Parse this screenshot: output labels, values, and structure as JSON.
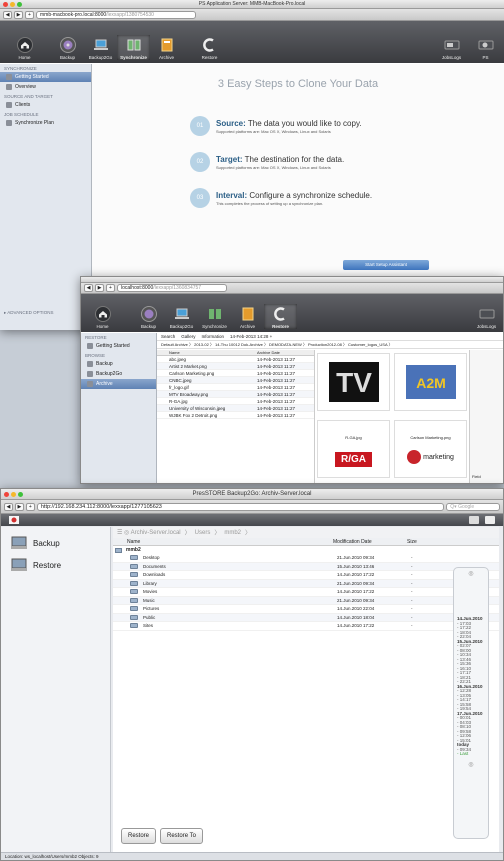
{
  "win1": {
    "title": "PS Application Server: MMB-MacBook-Pro.local",
    "url_host": "mmb-macbook-pro.local:8000",
    "url_path": "/lexxapp/1380754530",
    "toolbar": [
      {
        "label": "Home",
        "icon": "home-icon"
      },
      {
        "label": "Backup",
        "icon": "backup-icon"
      },
      {
        "label": "Backup2Go",
        "icon": "backup2go-icon"
      },
      {
        "label": "Synchronize",
        "icon": "synchronize-icon"
      },
      {
        "label": "Archive",
        "icon": "archive-icon"
      },
      {
        "label": "Restore",
        "icon": "restore-icon"
      }
    ],
    "toolbar_right": [
      {
        "label": "JobsLogs"
      },
      {
        "label": "PS"
      }
    ],
    "sidebar": {
      "h1": "SYNCHRONIZE",
      "getting_started": "Getting Started",
      "overview": "Overview",
      "h2": "SOURCE AND TARGET",
      "clients": "Clients",
      "h3": "JOB SCHEDULE",
      "sync_plan": "Synchronize Plan",
      "advanced": "ADVANCED OPTIONS"
    },
    "heading": "3 Easy Steps to Clone Your Data",
    "steps": [
      {
        "num": "01",
        "key": "Source:",
        "text": " The data you would like to copy.",
        "sub": "Supported platforms are: Mac OS X, Windows, Linux and Solaris"
      },
      {
        "num": "02",
        "key": "Target:",
        "text": " The destination for the data.",
        "sub": "Supported platforms are: Mac OS X, Windows, Linux and Solaris"
      },
      {
        "num": "03",
        "key": "Interval:",
        "text": " Configure a synchronize schedule.",
        "sub": "This completes the process of setting up a synchronize plan."
      }
    ],
    "assistant_button": "Start Setup Assistant"
  },
  "win2": {
    "url_host": "localhost:8000",
    "url_path": "/lexxapp/1360834757",
    "toolbar": [
      "Home",
      "Backup",
      "Backup2Go",
      "Synchronize",
      "Archive",
      "Restore"
    ],
    "toolbar_right": "JobsLogs",
    "sidebar": {
      "h1": "RESTORE",
      "getting_started": "Getting Started",
      "h2": "BROWSE",
      "backup": "Backup",
      "backup2go": "Backup2Go",
      "archive": "Archive"
    },
    "tabs": [
      "Search",
      "Gallery",
      "Information",
      "14-Feb-2013 14:28 +"
    ],
    "breadcrumb": "Default Archive 〉 2013-02 〉 14-Thu 10012 Dok-Archive 〉 DEMODATA-NEW 〉 Production2012-08 〉 Customer_logos_USA 〉",
    "cols": [
      "Name",
      "Archive Date"
    ],
    "files": [
      {
        "n": "abc.jpeg",
        "d": "14-Feb-2013 11:27"
      },
      {
        "n": "Artist 2 Market.png",
        "d": "14-Feb-2013 11:27"
      },
      {
        "n": "Carlson Marketing.png",
        "d": "14-Feb-2013 11:27"
      },
      {
        "n": "CNBC.jpeg",
        "d": "14-Feb-2013 11:27"
      },
      {
        "n": "fr_logo.gif",
        "d": "14-Feb-2013 11:27"
      },
      {
        "n": "MTV Broadway.png",
        "d": "14-Feb-2013 11:27"
      },
      {
        "n": "R-GA.jpg",
        "d": "14-Feb-2013 11:27"
      },
      {
        "n": "University of Wisconsin.jpeg",
        "d": "14-Feb-2013 11:27"
      },
      {
        "n": "WJBK Fox 2 Detroit.png",
        "d": "14-Feb-2013 11:27"
      }
    ],
    "thumbs": [
      {
        "cap": ""
      },
      {
        "cap": ""
      },
      {
        "cap": "R-GA.jpg",
        "logo": "R/GA"
      },
      {
        "cap": "Carlson Marketing.png",
        "logo": "marketing"
      }
    ],
    "field_label": "Field"
  },
  "win3": {
    "title": "PresSTORE Backup2Go: Archiv-Server.local",
    "url": "http://192.168.234.112:8000/lexxapp/1277105623",
    "search_placeholder": "Google",
    "nav": [
      "Backup",
      "Restore"
    ],
    "breadcrumb": [
      "Archiv-Server.local",
      "Users",
      "mmb2"
    ],
    "cols": [
      "Name",
      "Modification Date",
      "Size"
    ],
    "root": "mmb2",
    "rows": [
      {
        "n": "Desktop",
        "d": "21.Jun.2010 09:34",
        "s": "-"
      },
      {
        "n": "Documents",
        "d": "15.Jun.2010 13:46",
        "s": "-"
      },
      {
        "n": "Downloads",
        "d": "14.Jun.2010 17:22",
        "s": "-"
      },
      {
        "n": "Library",
        "d": "21.Jun.2010 09:34",
        "s": "-"
      },
      {
        "n": "Movies",
        "d": "14.Jun.2010 17:22",
        "s": "-"
      },
      {
        "n": "Music",
        "d": "21.Jun.2010 09:34",
        "s": "-"
      },
      {
        "n": "Pictures",
        "d": "14.Jun.2010 22:04",
        "s": "-"
      },
      {
        "n": "Public",
        "d": "14.Jun.2010 18:04",
        "s": "-"
      },
      {
        "n": "Sites",
        "d": "14.Jun.2010 17:22",
        "s": "-"
      }
    ],
    "timeline": [
      {
        "d": "14.Jun.2010",
        "t": [
          "- 17:03",
          "- 17:22",
          "- 18:04",
          "- 22:04"
        ]
      },
      {
        "d": "15.Jun.2010",
        "t": [
          "- 02:07",
          "- 08:00",
          "- 10:34",
          "- 13:46",
          "- 15:36",
          "- 16:10",
          "- 17:17",
          "- 18:21",
          "- 22:21"
        ]
      },
      {
        "d": "16.Jun.2010",
        "t": [
          "- 12:28",
          "- 13:05",
          "- 14:17",
          "- 15:58",
          "- 19:54"
        ]
      },
      {
        "d": "17.Jun.2010",
        "t": [
          "- 00:01",
          "- 04:03",
          "- 08:10",
          "- 09:58",
          "- 12:06",
          "- 15:01"
        ]
      },
      {
        "d": "today",
        "t": [
          "- 09:34",
          "- Last"
        ]
      }
    ],
    "restore": "Restore",
    "restore_to": "Restore To",
    "status": "Location: ws_localhost/Users/mmb2   Objects: 9"
  }
}
